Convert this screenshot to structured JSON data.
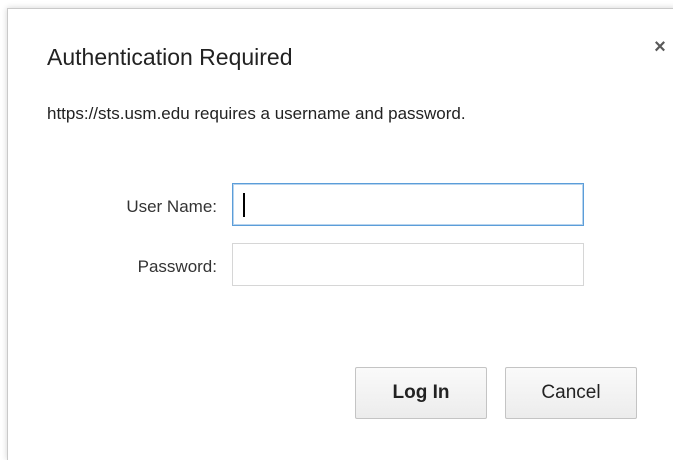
{
  "dialog": {
    "title": "Authentication Required",
    "message": "https://sts.usm.edu requires a username and password.",
    "close_icon": "×",
    "fields": {
      "username_label": "User Name:",
      "username_value": "",
      "password_label": "Password:",
      "password_value": ""
    },
    "buttons": {
      "login": "Log In",
      "cancel": "Cancel"
    }
  },
  "colors": {
    "focus_border": "#5b9dd9",
    "text": "#222222",
    "button_border": "#c4c4c4"
  }
}
